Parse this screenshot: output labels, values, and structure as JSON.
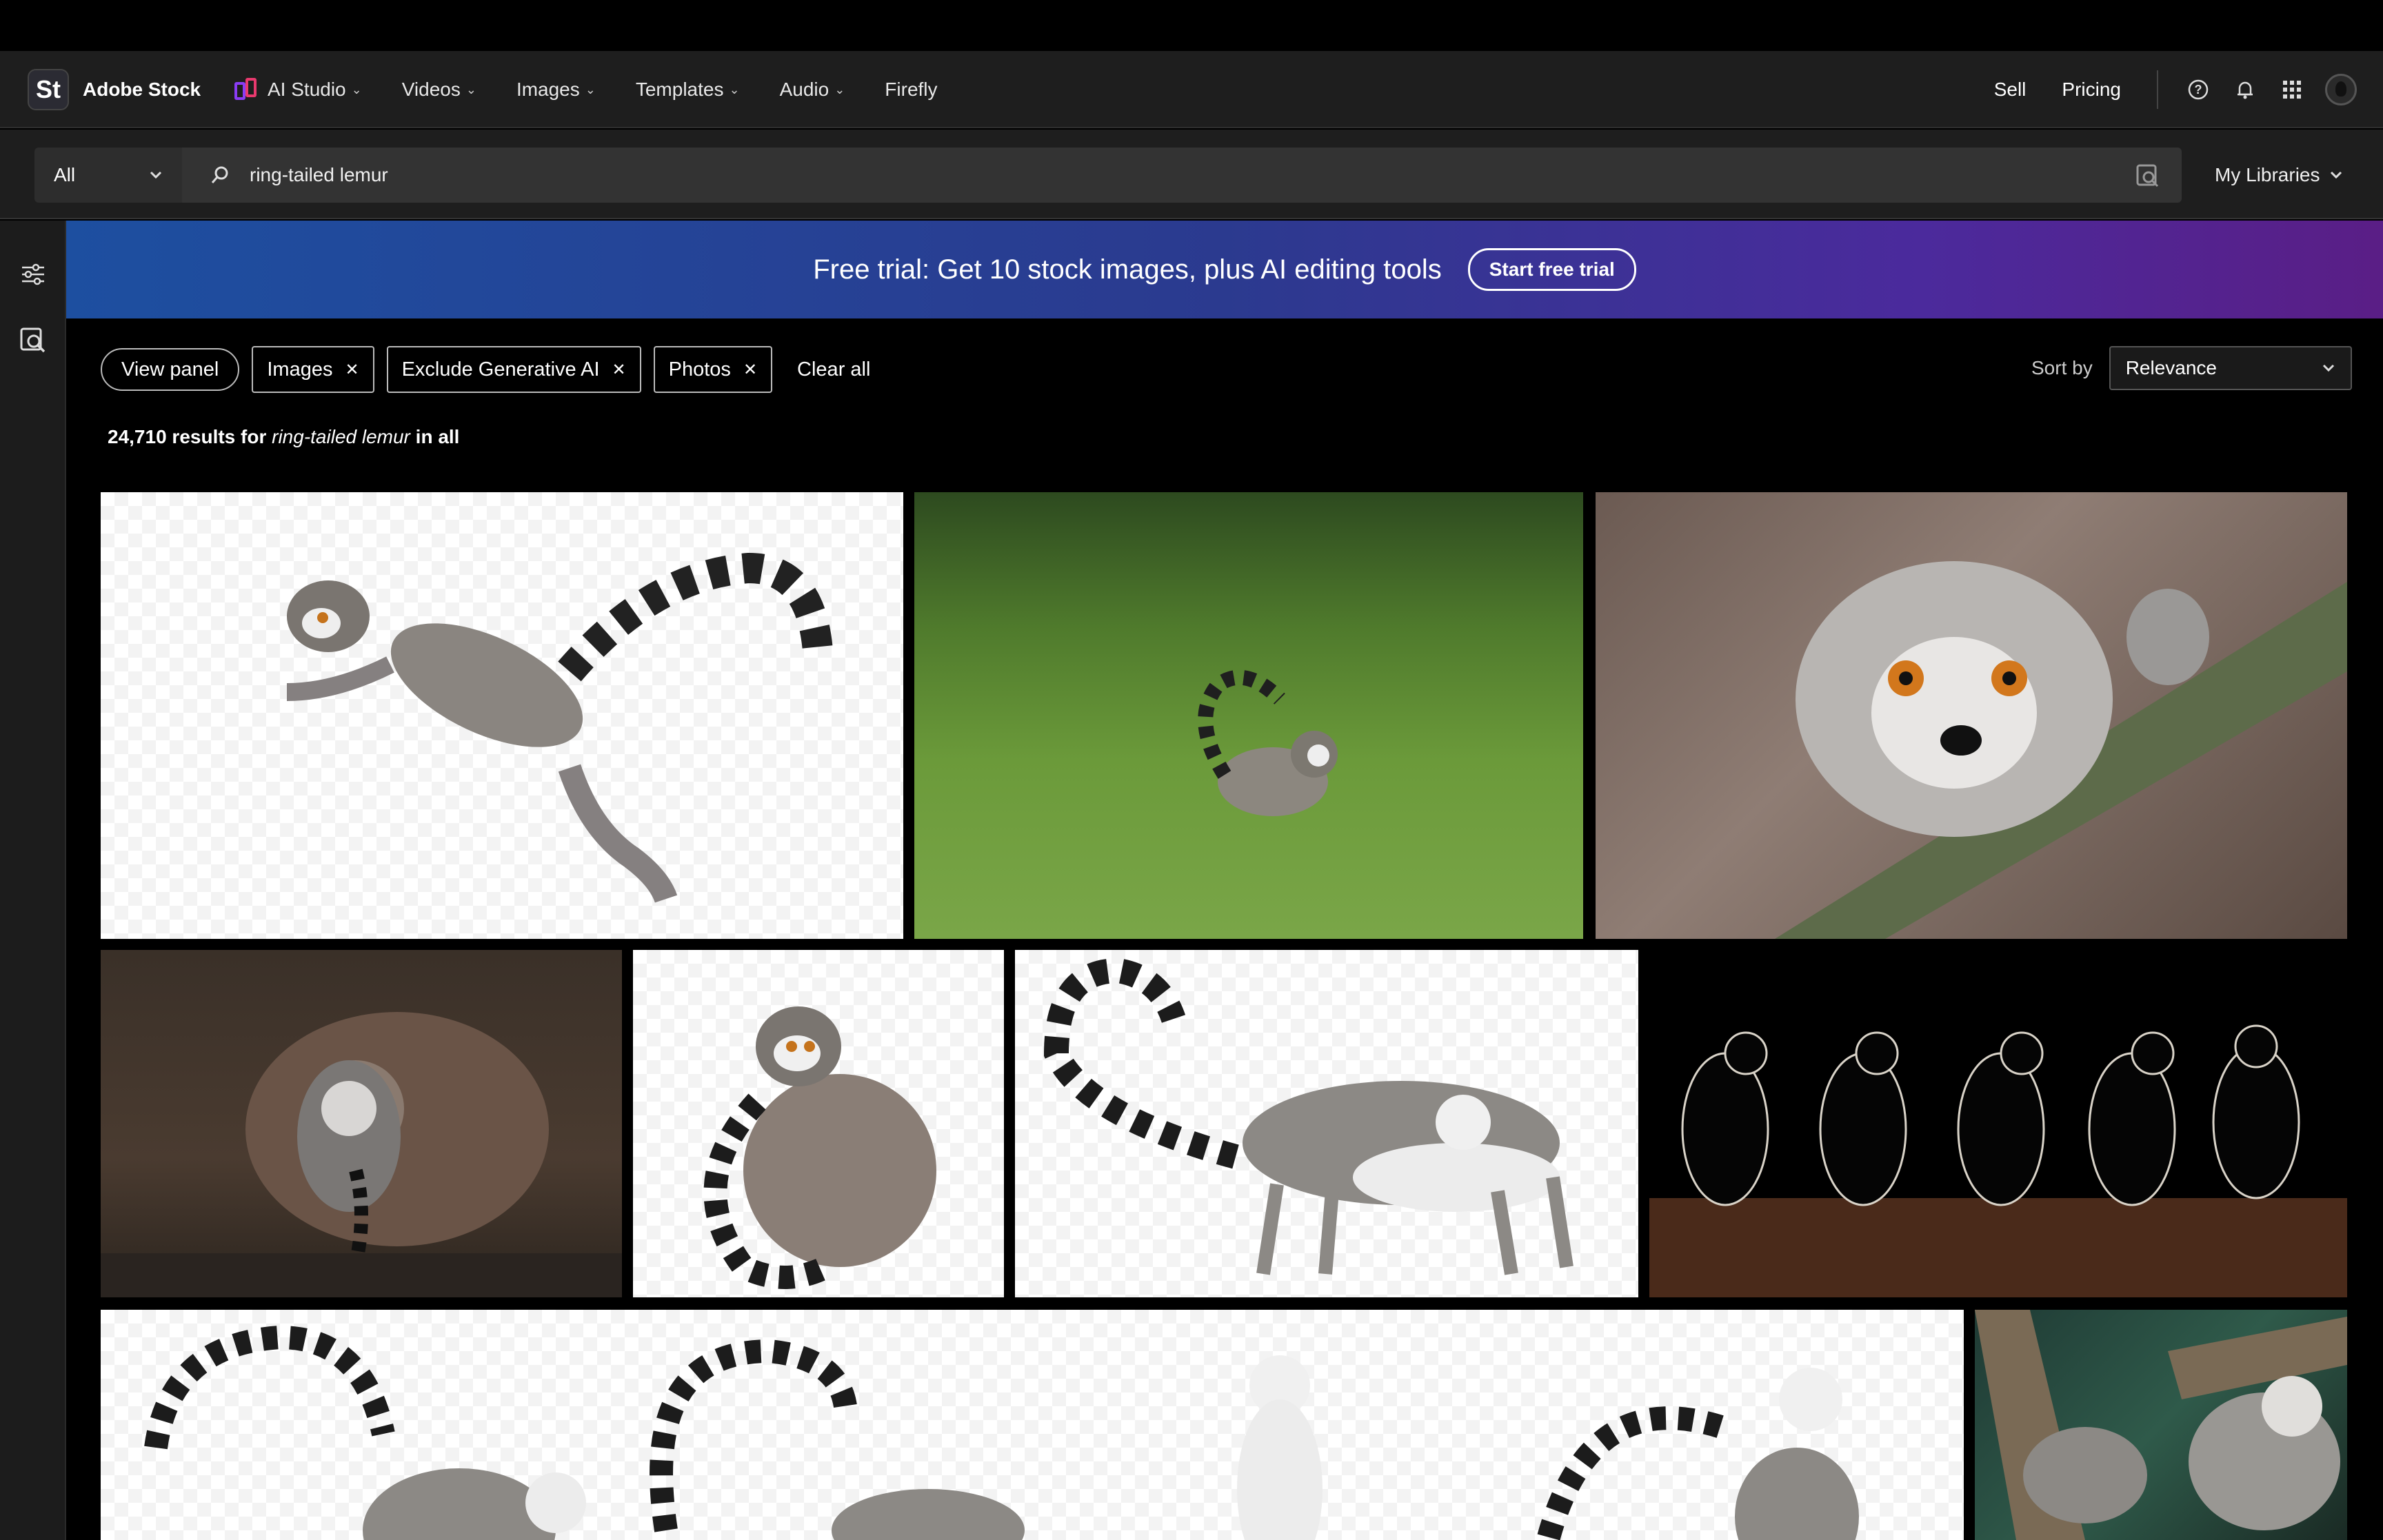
{
  "brand": {
    "logo_text": "St",
    "name": "Adobe Stock"
  },
  "nav": {
    "items": [
      {
        "label": "AI Studio",
        "has_menu": true
      },
      {
        "label": "Videos",
        "has_menu": true
      },
      {
        "label": "Images",
        "has_menu": true
      },
      {
        "label": "Templates",
        "has_menu": true
      },
      {
        "label": "Audio",
        "has_menu": true
      },
      {
        "label": "Firefly",
        "has_menu": false
      }
    ],
    "right_links": [
      "Sell",
      "Pricing"
    ],
    "icons": [
      "help-icon",
      "bell-icon",
      "apps-grid-icon",
      "avatar"
    ]
  },
  "search": {
    "scope": "All",
    "query": "ring-tailed lemur",
    "libraries_label": "My Libraries"
  },
  "banner": {
    "text": "Free trial: Get 10 stock images, plus AI editing tools",
    "button": "Start free trial"
  },
  "filters": {
    "view_panel": "View panel",
    "chips": [
      "Images",
      "Exclude Generative AI",
      "Photos"
    ],
    "clear_all": "Clear all"
  },
  "sort": {
    "label": "Sort by",
    "value": "Relevance"
  },
  "results": {
    "count": "24,710",
    "mid": "results for",
    "query": "ring-tailed lemur",
    "scope": "in all"
  },
  "colors": {
    "banner_start": "#1d4fa0",
    "banner_end": "#5a1e86",
    "background": "#000000",
    "nav": "#1e1e1e"
  },
  "tiles": [
    {
      "subject": "leaping lemur on transparent background"
    },
    {
      "subject": "lemur walking in grass"
    },
    {
      "subject": "lemur close-up on rail"
    },
    {
      "subject": "mother lemur with baby"
    },
    {
      "subject": "sitting lemur on transparent background"
    },
    {
      "subject": "walking lemur on transparent background"
    },
    {
      "subject": "five lemurs silhouetted"
    },
    {
      "subject": "group of lemurs on transparent background"
    },
    {
      "subject": "lemurs in tree"
    }
  ]
}
